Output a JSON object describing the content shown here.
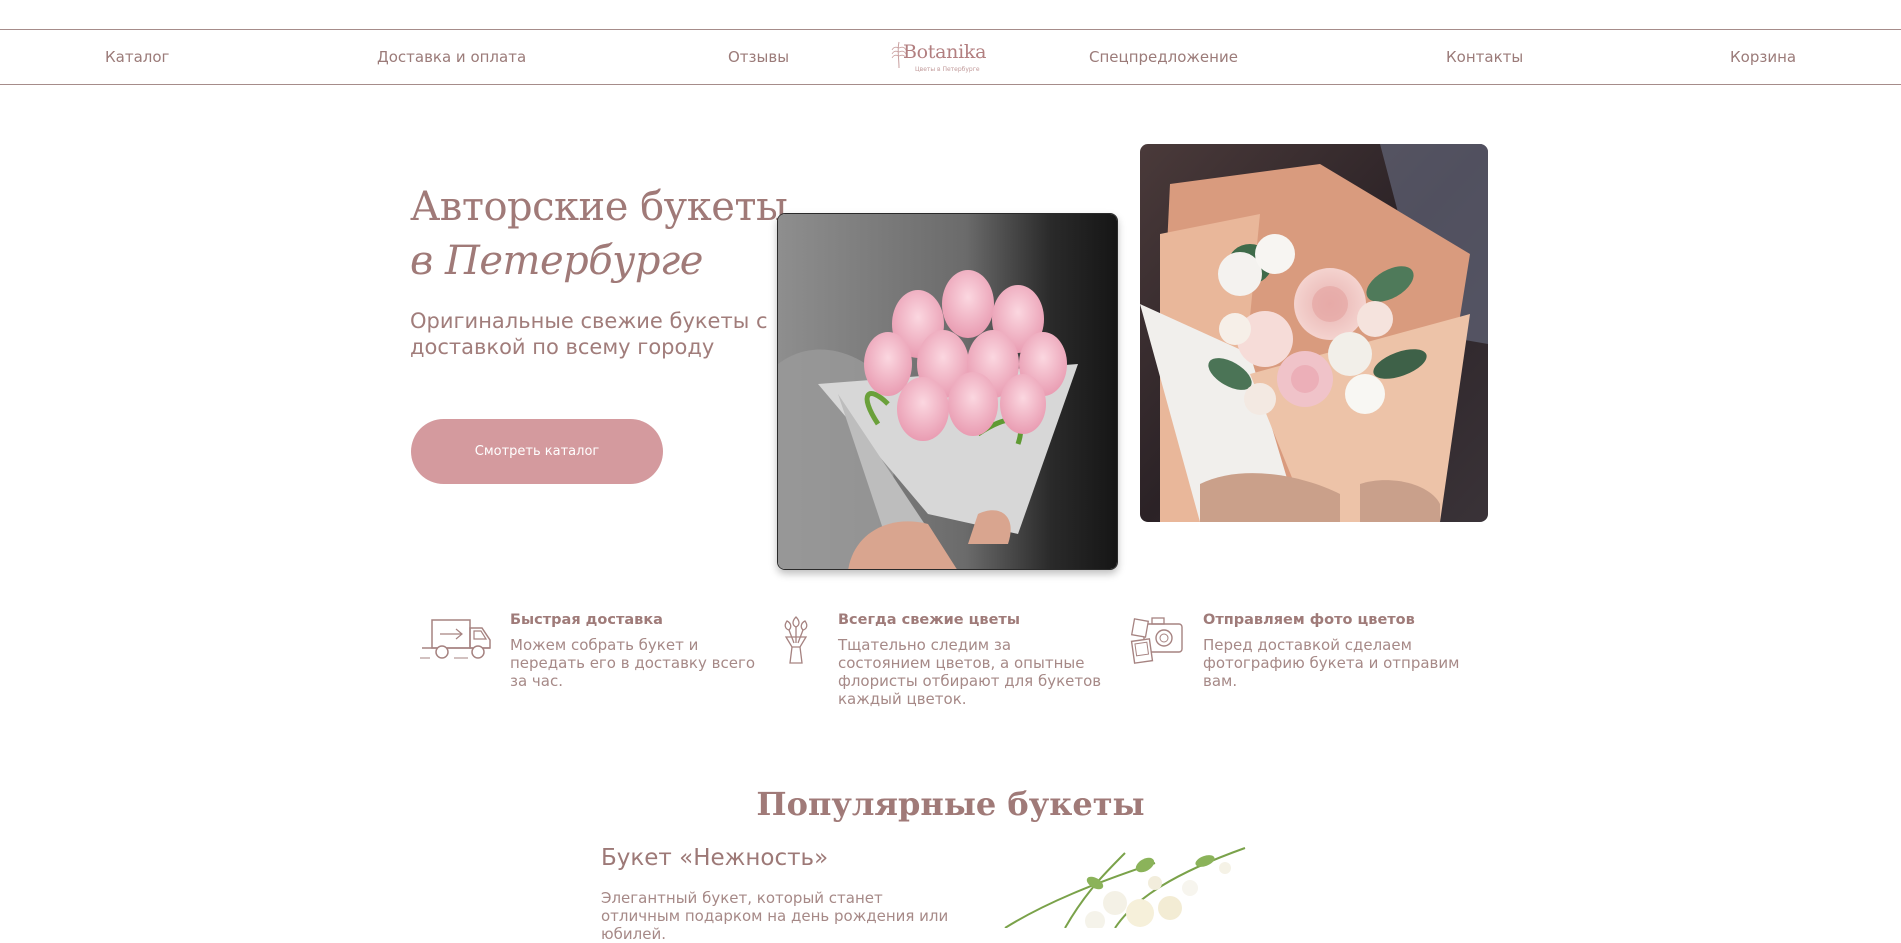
{
  "nav": {
    "links": [
      "Каталог",
      "Доставка и оплата",
      "Отзывы",
      "Спецпредложение",
      "Контакты",
      "Корзина"
    ],
    "logo_text": "Botanika",
    "logo_subtitle": "Цветы в Петербурге"
  },
  "hero": {
    "title_line1": "Авторские букеты",
    "title_line2": "в Петербурге",
    "subtitle": "Оригинальные свежие букеты с доставкой по всему городу",
    "cta_label": "Смотреть каталог"
  },
  "features": [
    {
      "icon": "delivery-truck-icon",
      "title": "Быстрая доставка",
      "text": "Можем собрать букет и передать его в доставку всего за час."
    },
    {
      "icon": "flower-bouquet-icon",
      "title": "Всегда свежие цветы",
      "text": "Тщательно следим за состоянием цветов, а опытные флористы отбирают для букетов каждый цветок."
    },
    {
      "icon": "camera-photo-icon",
      "title": "Отправляем фото цветов",
      "text": "Перед доставкой сделаем фотографию букета и отправим вам."
    }
  ],
  "popular": {
    "title": "Популярные букеты",
    "product_title": "Букет «Нежность»",
    "product_desc": "Элегантный букет, который станет отличным подарком на день рождения или юбилей."
  },
  "colors": {
    "accent": "#d49a9e",
    "text": "#9c7a78",
    "border": "#a68c8a"
  }
}
